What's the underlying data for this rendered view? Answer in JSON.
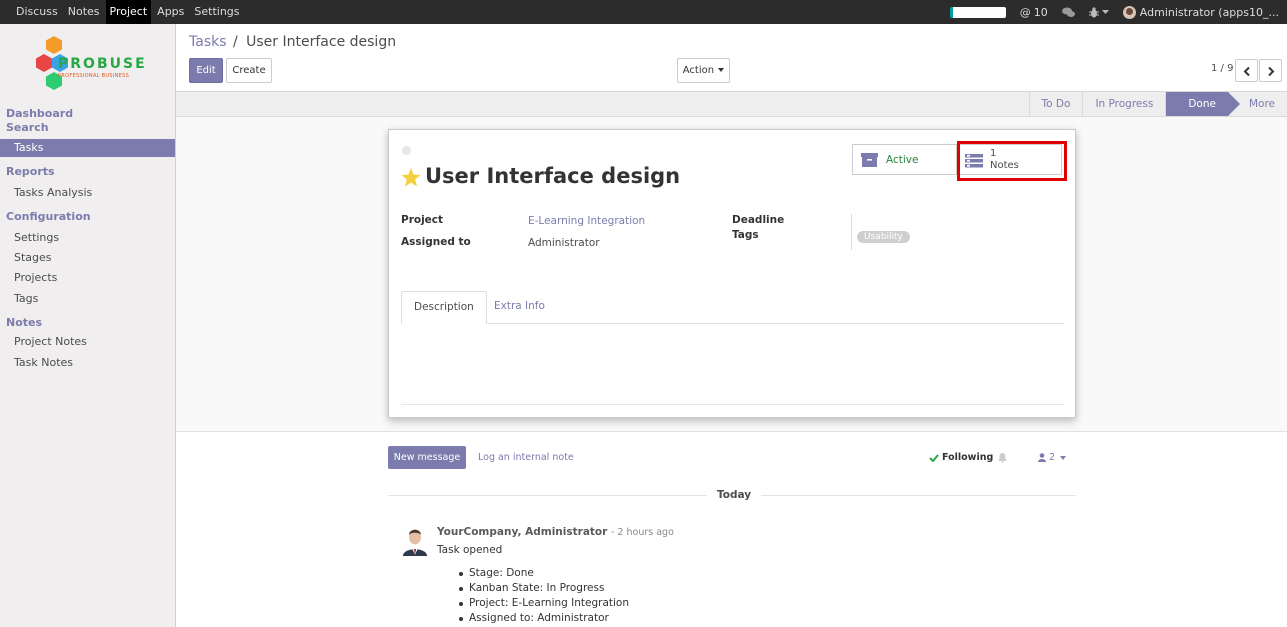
{
  "topbar": {
    "apps": [
      "Discuss",
      "Notes",
      "Project",
      "Apps",
      "Settings"
    ],
    "active_app": "Project",
    "messages_count": "10",
    "user_label": "Administrator (apps10_..."
  },
  "sidebar": {
    "logo_text": "PROBUSE",
    "logo_sub": "PROFESSIONAL BUSINESS",
    "sections": [
      {
        "head": "Dashboard",
        "items": []
      },
      {
        "head": "Search",
        "items": [
          "Tasks"
        ]
      },
      {
        "head": "Reports",
        "items": [
          "Tasks Analysis"
        ]
      },
      {
        "head": "Configuration",
        "items": [
          "Settings",
          "Stages",
          "Projects",
          "Tags"
        ]
      },
      {
        "head": "Notes",
        "items": [
          "Project Notes",
          "Task Notes"
        ]
      }
    ],
    "active_item": "Tasks"
  },
  "control": {
    "breadcrumb_parent": "Tasks",
    "breadcrumb_sep": "/",
    "breadcrumb_current": "User Interface design",
    "edit_label": "Edit",
    "create_label": "Create",
    "action_label": "Action",
    "pager_text": "1 / 9"
  },
  "stages": [
    "To Do",
    "In Progress",
    "Done",
    "More"
  ],
  "active_stage": "Done",
  "task": {
    "title": "User Interface design",
    "active_label": "Active",
    "notes_count": "1",
    "notes_label": "Notes",
    "fields": {
      "project_label": "Project",
      "project_value": "E-Learning Integration",
      "assigned_label": "Assigned to",
      "assigned_value": "Administrator",
      "deadline_label": "Deadline",
      "tags_label": "Tags",
      "tag_value": "Usability"
    },
    "tabs": [
      "Description",
      "Extra Info"
    ]
  },
  "chatter": {
    "new_message_label": "New message",
    "log_note_label": "Log an internal note",
    "following_label": "Following",
    "followers_count": "2",
    "date_sep": "Today",
    "message": {
      "author": "YourCompany, Administrator",
      "time": "- 2 hours ago",
      "body": "Task opened",
      "changes": [
        "Stage: Done",
        "Kanban State: In Progress",
        "Project: E-Learning Integration",
        "Assigned to: Administrator"
      ]
    }
  },
  "colors": {
    "brand": "#7c7bad",
    "topbar": "#2c2c2c",
    "highlight": "#e00000",
    "active_green": "#28823c"
  }
}
